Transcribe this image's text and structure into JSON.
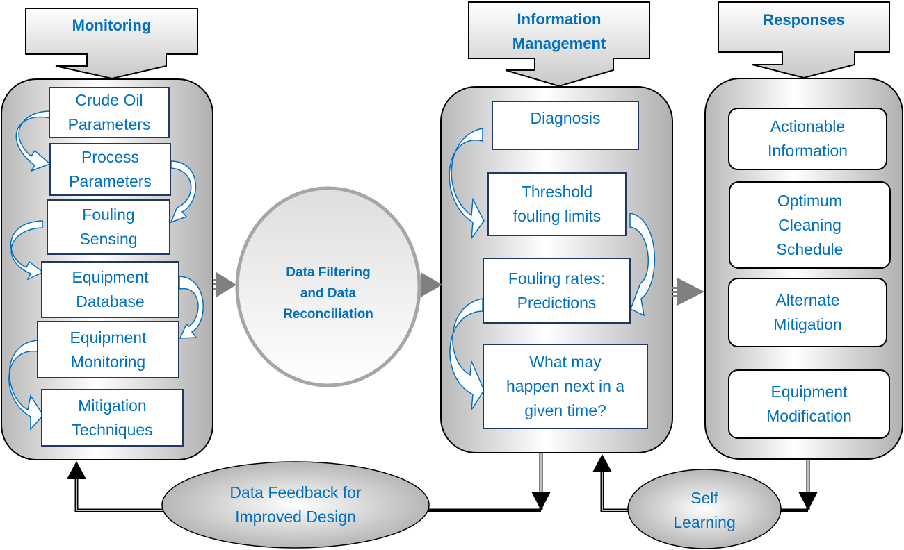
{
  "colors": {
    "text_accent": "#0070c0",
    "box_border": "#1f3864",
    "panel_border": "#000000",
    "connector_gray": "#808080"
  },
  "monitoring": {
    "header": "Monitoring",
    "items": [
      "Crude Oil\nParameters",
      "Process\nParameters",
      "Fouling\nSensing",
      "Equipment\nDatabase",
      "Equipment\nMonitoring",
      "Mitigation\nTechniques"
    ]
  },
  "filter_node": {
    "label": "Data Filtering\nand Data\nReconciliation"
  },
  "information_management": {
    "header": "Information\nManagement",
    "items": [
      "Diagnosis",
      "Threshold\nfouling limits",
      "Fouling rates:\nPredictions",
      "What may\nhappen next in a\ngiven time?"
    ]
  },
  "responses": {
    "header": "Responses",
    "items": [
      "Actionable\nInformation",
      "Optimum\nCleaning\nSchedule",
      "Alternate\nMitigation",
      "Equipment\nModification"
    ]
  },
  "feedback_nodes": {
    "design_feedback": "Data Feedback for\nImproved Design",
    "self_learning": "Self\nLearning"
  }
}
